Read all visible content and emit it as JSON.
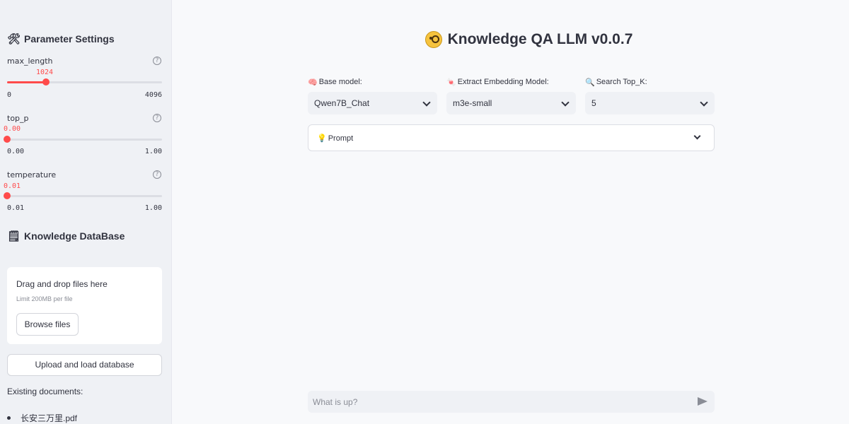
{
  "sidebar": {
    "parameter_heading": {
      "icon": "wrench-screwdriver-icon",
      "emoji": "🛠",
      "label": "Parameter Settings"
    },
    "sliders": [
      {
        "label": "max_length",
        "value": "1024",
        "min": "0",
        "max": "4096",
        "fraction": 0.25
      },
      {
        "label": "top_p",
        "value": "0.00",
        "min": "0.00",
        "max": "1.00",
        "fraction": 0.0
      },
      {
        "label": "temperature",
        "value": "0.01",
        "min": "0.01",
        "max": "1.00",
        "fraction": 0.0
      }
    ],
    "knowledge_heading": {
      "icon": "note-icon",
      "emoji": "🗒",
      "label": "Knowledge DataBase"
    },
    "uploader": {
      "drag_text": "Drag and drop files here",
      "limit_text": "Limit 200MB per file",
      "browse_label": "Browse files"
    },
    "upload_button": "Upload and load database",
    "existing_label": "Existing documents:",
    "documents": [
      "长安三万里.pdf"
    ]
  },
  "main": {
    "title": "Knowledge QA LLM v0.0.7",
    "title_icon": "face-with-monocle-icon",
    "selects": [
      {
        "icon": "brain-icon",
        "emoji": "🧠",
        "label": "Base model:",
        "value": "Qwen7B_Chat"
      },
      {
        "icon": "candy-icon",
        "emoji": "🍬",
        "label": "Extract Embedding Model:",
        "value": "m3e-small"
      },
      {
        "icon": "magnifier-icon",
        "emoji": "🔍",
        "label": "Search Top_K:",
        "value": "5"
      }
    ],
    "prompt": {
      "icon": "lightbulb-icon",
      "emoji": "💡",
      "label": "Prompt"
    },
    "chat": {
      "placeholder": "What is up?"
    }
  },
  "colors": {
    "accent": "#ff4b4b",
    "sidebar_bg": "#eff1f5",
    "main_bg": "#f8f9fb"
  }
}
